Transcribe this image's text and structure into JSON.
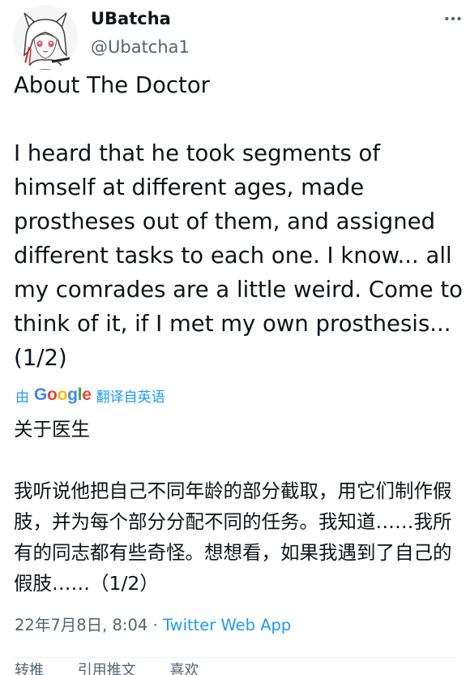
{
  "author": {
    "display_name": "UBatcha",
    "handle": "@Ubatcha1"
  },
  "tweet": {
    "text": "About The Doctor\n\nI heard that he took segments of himself at different ages, made prostheses out of them, and assigned different tasks to each one. I know... all my comrades are a little weird. Come to think of it, if I met my own prosthesis... (1/2)"
  },
  "translation": {
    "prefix": "由",
    "provider": "Google",
    "suffix": "翻译自英语",
    "text": "关于医生\n\n我听说他把自己不同年龄的部分截取，用它们制作假肢，并为每个部分分配不同的任务。我知道……我所有的同志都有些奇怪。想想看，如果我遇到了自己的假肢……（1/2）"
  },
  "meta": {
    "date": "22年7月8日",
    "time": "8:04",
    "separator": "·",
    "source": "Twitter Web App"
  },
  "stats": {
    "retweets": "转推",
    "quotes": "引用推文",
    "likes": "喜欢"
  },
  "colors": {
    "accent": "#1d9bf0",
    "secondary_text": "#536471",
    "primary_text": "#0f1419"
  }
}
